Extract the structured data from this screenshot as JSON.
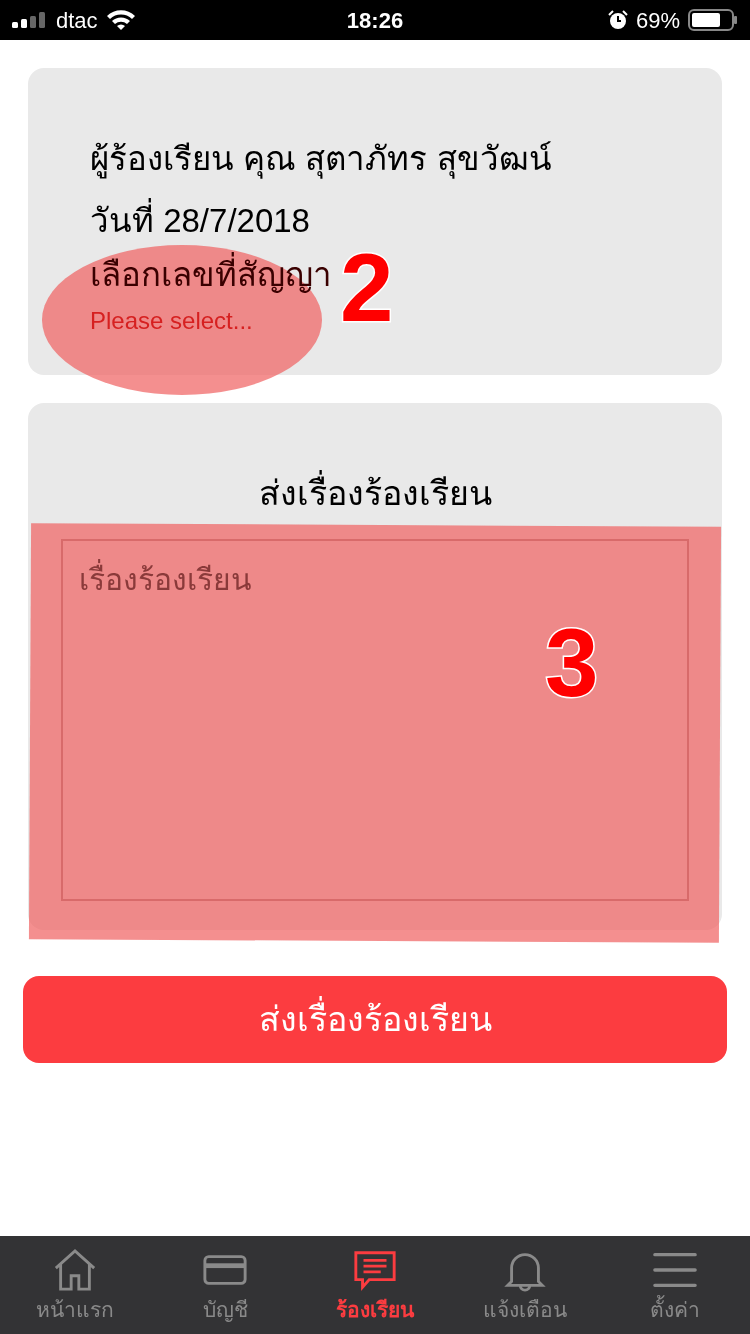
{
  "status_bar": {
    "carrier": "dtac",
    "time": "18:26",
    "battery": "69%"
  },
  "info_card": {
    "complainant": "ผู้ร้องเรียน คุณ สุตาภัทร สุขวัฒน์",
    "date": "วันที่ 28/7/2018",
    "contract_label": "เลือกเลขที่สัญญา",
    "contract_placeholder": "Please select..."
  },
  "form_card": {
    "title": "ส่งเรื่องร้องเรียน",
    "complaint_placeholder": "เรื่องร้องเรียน"
  },
  "submit_button": "ส่งเรื่องร้องเรียน",
  "tabs": [
    {
      "label": "หน้าแรก",
      "selected": false
    },
    {
      "label": "บัญชี",
      "selected": false
    },
    {
      "label": "ร้องเรียน",
      "selected": true
    },
    {
      "label": "แจ้งเตือน",
      "selected": false
    },
    {
      "label": "ตั้งค่า",
      "selected": false
    }
  ],
  "annotations": [
    {
      "kind": "ellipse",
      "label": "2"
    },
    {
      "kind": "rectangle",
      "label": "3"
    }
  ]
}
